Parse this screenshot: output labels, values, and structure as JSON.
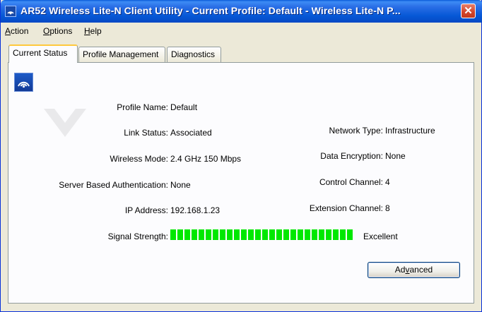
{
  "window": {
    "title": "AR52 Wireless Lite-N Client Utility - Current Profile: Default - Wireless Lite-N P...",
    "close_label": "✕",
    "accent": "#0a5ad8"
  },
  "menu": {
    "items": [
      {
        "label": "Action",
        "accel": "A",
        "rest": "ction"
      },
      {
        "label": "Options",
        "accel": "O",
        "rest": "ptions"
      },
      {
        "label": "Help",
        "accel": "H",
        "rest": "elp"
      }
    ]
  },
  "tabs": [
    {
      "label": "Current Status",
      "active": true
    },
    {
      "label": "Profile Management",
      "active": false
    },
    {
      "label": "Diagnostics",
      "active": false
    }
  ],
  "status": {
    "profile_name": {
      "label": "Profile Name:",
      "value": "Default"
    },
    "link_status": {
      "label": "Link Status:",
      "value": "Associated"
    },
    "wireless_mode": {
      "label": "Wireless Mode:",
      "value": "2.4 GHz 150 Mbps"
    },
    "server_auth": {
      "label": "Server Based Authentication:",
      "value": "None"
    },
    "ip_address": {
      "label": "IP Address:",
      "value": "192.168.1.23"
    },
    "network_type": {
      "label": "Network Type:",
      "value": "Infrastructure"
    },
    "data_encryption": {
      "label": "Data Encryption:",
      "value": "None"
    },
    "control_channel": {
      "label": "Control Channel:",
      "value": "4"
    },
    "extension_channel": {
      "label": "Extension Channel:",
      "value": "8"
    },
    "signal_strength": {
      "label": "Signal Strength:",
      "value": "Excellent",
      "level": 1.0,
      "color": "#00e800"
    }
  },
  "advanced_button": {
    "label": "Advanced",
    "accel": "v",
    "before": "Ad",
    "after": "anced"
  },
  "icons": {
    "app": "wireless-signal-icon"
  }
}
